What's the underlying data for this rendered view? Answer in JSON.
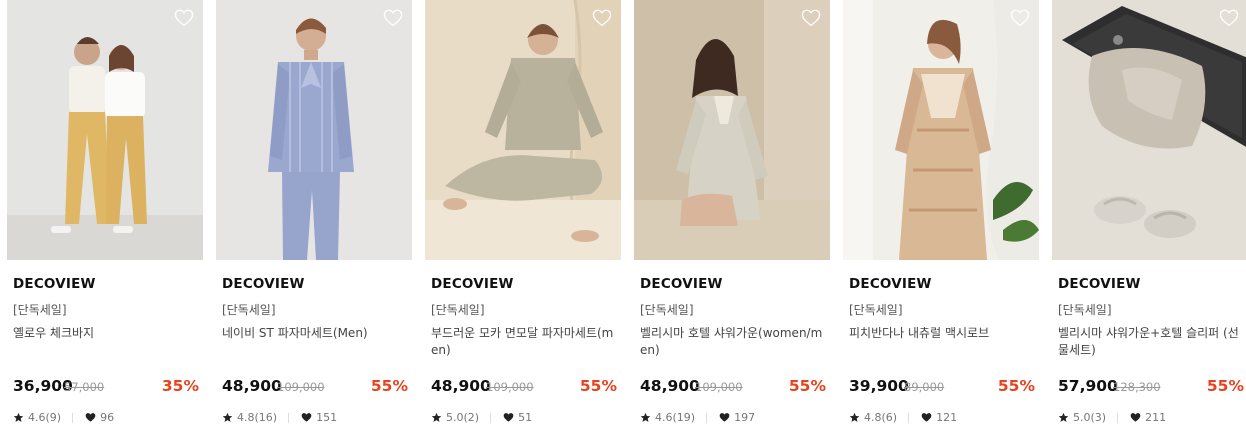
{
  "colors": {
    "discount": "#e8421e",
    "text": "#111111",
    "muted": "#999999"
  },
  "products": [
    {
      "brand": "DECOVIEW",
      "tag": "[단독세일]",
      "name": "옐로우 체크바지",
      "price": "36,900",
      "original_price": "57,000",
      "discount": "35%",
      "rating": "4.6(9)",
      "likes": "96",
      "star_icon": "star-icon",
      "like_icon": "heart-icon"
    },
    {
      "brand": "DECOVIEW",
      "tag": "[단독세일]",
      "name": "네이비 ST 파자마세트(Men)",
      "price": "48,900",
      "original_price": "109,000",
      "discount": "55%",
      "rating": "4.8(16)",
      "likes": "151",
      "star_icon": "star-icon",
      "like_icon": "heart-icon"
    },
    {
      "brand": "DECOVIEW",
      "tag": "[단독세일]",
      "name": "부드러운 모카 면모달 파자마세트(men)",
      "price": "48,900",
      "original_price": "109,000",
      "discount": "55%",
      "rating": "5.0(2)",
      "likes": "51",
      "star_icon": "star-icon",
      "like_icon": "heart-icon"
    },
    {
      "brand": "DECOVIEW",
      "tag": "[단독세일]",
      "name": "벨리시마 호텔 샤워가운(women/men)",
      "price": "48,900",
      "original_price": "109,000",
      "discount": "55%",
      "rating": "4.6(19)",
      "likes": "197",
      "star_icon": "star-icon",
      "like_icon": "heart-icon"
    },
    {
      "brand": "DECOVIEW",
      "tag": "[단독세일]",
      "name": "피치반다나 내츄럴 맥시로브",
      "price": "39,900",
      "original_price": "89,000",
      "discount": "55%",
      "rating": "4.8(6)",
      "likes": "121",
      "star_icon": "star-icon",
      "like_icon": "heart-icon"
    },
    {
      "brand": "DECOVIEW",
      "tag": "[단독세일]",
      "name": "벨리시마 샤워가운+호텔 슬리퍼 (선물세트)",
      "price": "57,900",
      "original_price": "128,300",
      "discount": "55%",
      "rating": "5.0(3)",
      "likes": "211",
      "star_icon": "star-icon",
      "like_icon": "heart-icon"
    }
  ]
}
